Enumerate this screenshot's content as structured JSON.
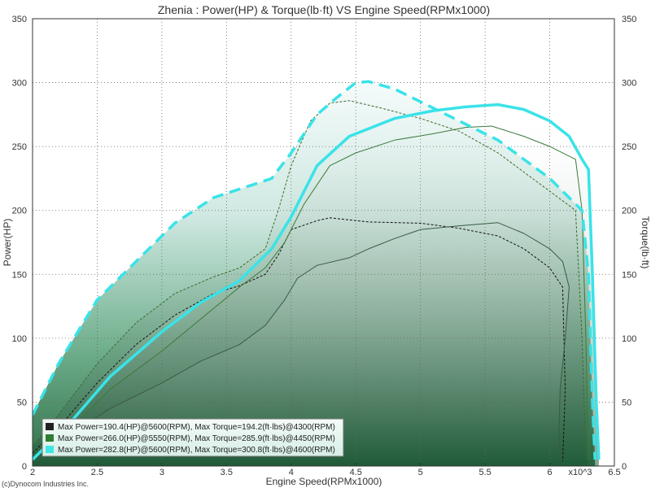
{
  "chart_data": {
    "type": "area",
    "title": "Zhenia : Power(HP) & Torque(lb·ft) VS Engine Speed(RPMx1000)",
    "xlabel": "Engine Speed(RPMx1000)",
    "ylabel": "Power(HP)",
    "y2label": "Torque(lb·ft)",
    "xlim": [
      2,
      6.5
    ],
    "ylim": [
      0,
      350
    ],
    "y2lim": [
      0,
      350
    ],
    "x_ticks": [
      "2",
      "2.5",
      "3",
      "3.5",
      "4",
      "4.5",
      "5",
      "5.5",
      "6",
      "6.5"
    ],
    "y_ticks": [
      "0",
      "50",
      "100",
      "150",
      "200",
      "250",
      "300",
      "350"
    ],
    "x_multiplier_label": "x10^3",
    "grid": true,
    "legend_position": "bottom-left",
    "legend": [
      "Max Power=190.4(HP)@5600(RPM), Max Torque=194.2(ft·lbs)@4300(RPM)",
      "Max Power=266.0(HP)@5550(RPM), Max Torque=285.9(ft·lbs)@4450(RPM)",
      "Max Power=282.8(HP)@5600(RPM), Max Torque=300.8(ft·lbs)@4600(RPM)"
    ],
    "copyright": "(c)Dynocom Industries Inc.",
    "series": [
      {
        "run": 1,
        "color": "#333333",
        "power": [
          [
            2.05,
            5
          ],
          [
            2.3,
            25
          ],
          [
            2.6,
            45
          ],
          [
            3.0,
            65
          ],
          [
            3.3,
            82
          ],
          [
            3.6,
            95
          ],
          [
            3.8,
            110
          ],
          [
            3.95,
            130
          ],
          [
            4.05,
            147
          ],
          [
            4.2,
            157
          ],
          [
            4.45,
            163
          ],
          [
            4.6,
            170
          ],
          [
            4.8,
            178
          ],
          [
            5.0,
            185
          ],
          [
            5.3,
            188
          ],
          [
            5.6,
            190.4
          ],
          [
            5.8,
            182
          ],
          [
            6.0,
            170
          ],
          [
            6.1,
            160
          ],
          [
            6.15,
            140
          ],
          [
            6.12,
            100
          ],
          [
            6.08,
            60
          ],
          [
            6.07,
            20
          ],
          [
            6.1,
            2
          ]
        ],
        "torque": [
          [
            2.0,
            10
          ],
          [
            2.2,
            30
          ],
          [
            2.5,
            65
          ],
          [
            2.8,
            95
          ],
          [
            3.1,
            118
          ],
          [
            3.4,
            135
          ],
          [
            3.6,
            141
          ],
          [
            3.8,
            150
          ],
          [
            3.9,
            165
          ],
          [
            4.0,
            185
          ],
          [
            4.2,
            192
          ],
          [
            4.3,
            194.2
          ],
          [
            4.6,
            191
          ],
          [
            5.0,
            190
          ],
          [
            5.3,
            186
          ],
          [
            5.6,
            180
          ],
          [
            5.8,
            170
          ],
          [
            6.0,
            155
          ],
          [
            6.1,
            140
          ],
          [
            6.12,
            60
          ],
          [
            6.1,
            2
          ]
        ]
      },
      {
        "run": 2,
        "color": "#2e7d32",
        "power": [
          [
            2.05,
            10
          ],
          [
            2.3,
            30
          ],
          [
            2.6,
            60
          ],
          [
            3.0,
            90
          ],
          [
            3.3,
            115
          ],
          [
            3.6,
            140
          ],
          [
            3.8,
            155
          ],
          [
            3.95,
            175
          ],
          [
            4.1,
            205
          ],
          [
            4.3,
            235
          ],
          [
            4.5,
            245
          ],
          [
            4.8,
            255
          ],
          [
            5.1,
            260
          ],
          [
            5.35,
            265
          ],
          [
            5.55,
            266.0
          ],
          [
            5.8,
            258
          ],
          [
            6.0,
            250
          ],
          [
            6.2,
            240
          ],
          [
            6.25,
            200
          ],
          [
            6.28,
            100
          ],
          [
            6.3,
            5
          ]
        ],
        "torque": [
          [
            2.0,
            15
          ],
          [
            2.2,
            40
          ],
          [
            2.5,
            80
          ],
          [
            2.8,
            112
          ],
          [
            3.1,
            135
          ],
          [
            3.4,
            148
          ],
          [
            3.6,
            155
          ],
          [
            3.8,
            170
          ],
          [
            3.9,
            200
          ],
          [
            4.0,
            235
          ],
          [
            4.15,
            270
          ],
          [
            4.3,
            284
          ],
          [
            4.45,
            285.9
          ],
          [
            4.7,
            280
          ],
          [
            5.0,
            272
          ],
          [
            5.3,
            262
          ],
          [
            5.6,
            245
          ],
          [
            5.8,
            230
          ],
          [
            6.0,
            215
          ],
          [
            6.2,
            200
          ],
          [
            6.25,
            100
          ],
          [
            6.28,
            5
          ]
        ]
      },
      {
        "run": 3,
        "color": "#3ee6e6",
        "power": [
          [
            2.0,
            5
          ],
          [
            2.3,
            35
          ],
          [
            2.6,
            70
          ],
          [
            3.0,
            105
          ],
          [
            3.3,
            128
          ],
          [
            3.6,
            145
          ],
          [
            3.85,
            170
          ],
          [
            4.0,
            195
          ],
          [
            4.2,
            235
          ],
          [
            4.45,
            258
          ],
          [
            4.8,
            272
          ],
          [
            5.1,
            278
          ],
          [
            5.35,
            281
          ],
          [
            5.6,
            282.8
          ],
          [
            5.8,
            279
          ],
          [
            6.0,
            270
          ],
          [
            6.15,
            258
          ],
          [
            6.25,
            240
          ],
          [
            6.3,
            232
          ],
          [
            6.33,
            150
          ],
          [
            6.36,
            50
          ],
          [
            6.38,
            5
          ]
        ],
        "torque": [
          [
            2.0,
            40
          ],
          [
            2.2,
            80
          ],
          [
            2.5,
            130
          ],
          [
            2.8,
            160
          ],
          [
            3.1,
            190
          ],
          [
            3.4,
            210
          ],
          [
            3.7,
            220
          ],
          [
            3.85,
            225
          ],
          [
            4.0,
            245
          ],
          [
            4.2,
            275
          ],
          [
            4.35,
            288
          ],
          [
            4.5,
            300
          ],
          [
            4.6,
            300.8
          ],
          [
            4.8,
            295
          ],
          [
            5.0,
            285
          ],
          [
            5.3,
            270
          ],
          [
            5.6,
            255
          ],
          [
            5.8,
            240
          ],
          [
            6.0,
            225
          ],
          [
            6.15,
            210
          ],
          [
            6.25,
            200
          ],
          [
            6.3,
            150
          ],
          [
            6.33,
            50
          ],
          [
            6.35,
            5
          ]
        ]
      }
    ]
  }
}
